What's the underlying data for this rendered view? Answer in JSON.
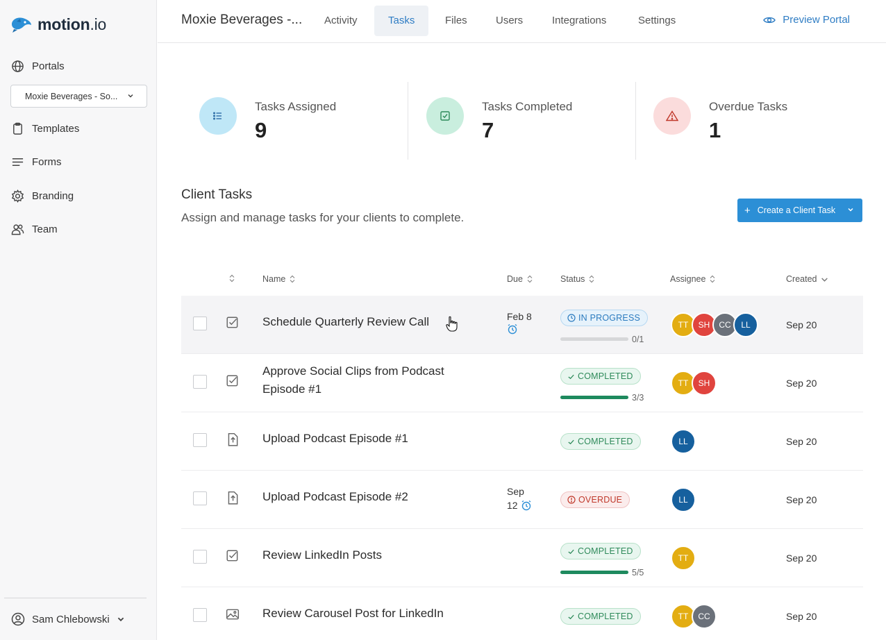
{
  "app": {
    "logo_text": "motion",
    "logo_suffix": ".io"
  },
  "sidebar": {
    "items": [
      {
        "label": "Portals",
        "icon": "globe-icon"
      },
      {
        "label": "Templates",
        "icon": "clipboard-icon"
      },
      {
        "label": "Forms",
        "icon": "lines-icon"
      },
      {
        "label": "Branding",
        "icon": "gear-icon"
      },
      {
        "label": "Team",
        "icon": "users-icon"
      }
    ],
    "portal_select": "Moxie Beverages - So...",
    "user": "Sam Chlebowski"
  },
  "header": {
    "title": "Moxie Beverages -...",
    "tabs": [
      "Activity",
      "Tasks",
      "Files",
      "Users",
      "Integrations",
      "Settings"
    ],
    "active_tab": "Tasks",
    "preview": "Preview Portal"
  },
  "stats": [
    {
      "label": "Tasks Assigned",
      "value": "9",
      "color": "#bfe7f7",
      "icon": "list-icon"
    },
    {
      "label": "Tasks Completed",
      "value": "7",
      "color": "#c9eede",
      "icon": "checkbox-icon"
    },
    {
      "label": "Overdue Tasks",
      "value": "1",
      "color": "#fbdcdc",
      "icon": "warning-icon"
    }
  ],
  "section": {
    "title": "Client Tasks",
    "subtitle": "Assign and manage tasks for your clients to complete.",
    "create_button": "Create a Client Task"
  },
  "table": {
    "headers": {
      "name": "Name",
      "due": "Due",
      "status": "Status",
      "assignee": "Assignee",
      "created": "Created"
    },
    "rows": [
      {
        "type": "checkbox-icon",
        "name": "Schedule Quarterly Review Call",
        "due1": "Feb 8",
        "due2": "",
        "status": "IN PROGRESS",
        "status_kind": "progress",
        "progress": 0.0,
        "count": "0/1",
        "assignees": [
          "TT",
          "SH",
          "CC",
          "LL"
        ],
        "created": "Sep 20"
      },
      {
        "type": "checkbox-icon",
        "name": "Approve Social Clips from Podcast Episode #1",
        "due1": "",
        "due2": "",
        "status": "COMPLETED",
        "status_kind": "completed",
        "progress": 1.0,
        "count": "3/3",
        "assignees": [
          "TT",
          "SH"
        ],
        "created": "Sep 20"
      },
      {
        "type": "upload-icon",
        "name": "Upload Podcast Episode #1",
        "due1": "",
        "due2": "",
        "status": "COMPLETED",
        "status_kind": "completed",
        "progress": null,
        "count": "",
        "assignees": [
          "LL"
        ],
        "created": "Sep 20"
      },
      {
        "type": "upload-icon",
        "name": "Upload Podcast Episode #2",
        "due1": "Sep",
        "due2": "12",
        "status": "OVERDUE",
        "status_kind": "overdue",
        "progress": null,
        "count": "",
        "assignees": [
          "LL"
        ],
        "created": "Sep 20"
      },
      {
        "type": "checkbox-icon",
        "name": "Review LinkedIn Posts",
        "due1": "",
        "due2": "",
        "status": "COMPLETED",
        "status_kind": "completed",
        "progress": 1.0,
        "count": "5/5",
        "assignees": [
          "TT"
        ],
        "created": "Sep 20"
      },
      {
        "type": "image-icon",
        "name": "Review Carousel Post for LinkedIn",
        "due1": "",
        "due2": "",
        "status": "COMPLETED",
        "status_kind": "completed",
        "progress": null,
        "count": "",
        "assignees": [
          "TT",
          "CC"
        ],
        "created": "Sep 20"
      }
    ]
  },
  "colors": {
    "accent": "#2c8fd6",
    "avatar_TT": "#e3ad12",
    "avatar_SH": "#e0443e",
    "avatar_CC": "#6b717a",
    "avatar_LL": "#16609e"
  }
}
